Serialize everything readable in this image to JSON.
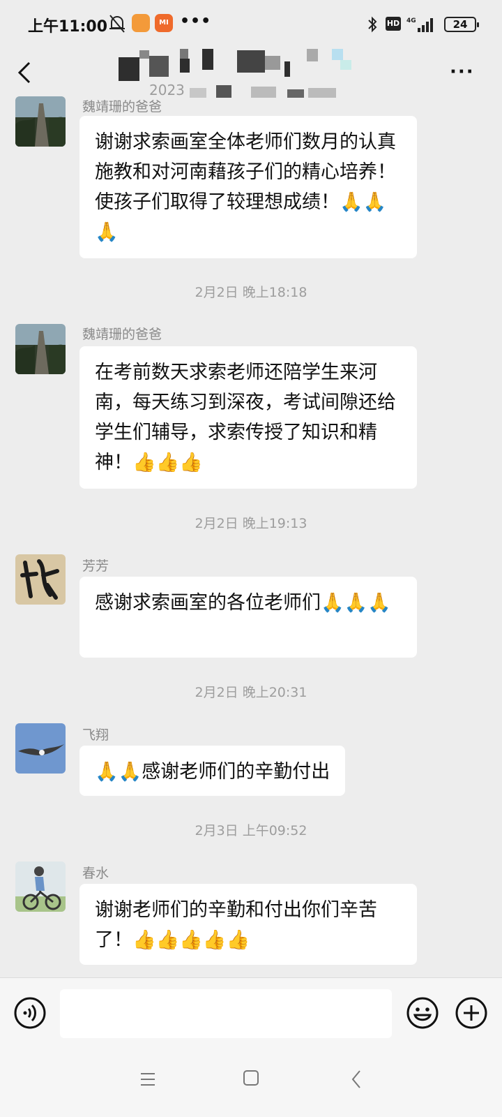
{
  "status_bar": {
    "time": "上午11:00",
    "app_icon_label": "MI",
    "more_dots": "•••",
    "hd_badge": "HD",
    "network": "4G",
    "battery": "24"
  },
  "header": {
    "more_label": "···"
  },
  "messages": [
    {
      "sender": "魏靖珊的爸爸",
      "text": "谢谢求索画室全体老师们数月的认真施教和对河南藉孩子们的精心培养！使孩子们取得了较理想成绩！🙏🙏🙏",
      "avatar": "mountain-photo"
    },
    {
      "sender": "魏靖珊的爸爸",
      "text": "在考前数天求索老师还陪学生来河南，每天练习到深夜，考试间隙还给学生们辅导，求索传授了知识和精神！👍👍👍",
      "avatar": "mountain-photo"
    },
    {
      "sender": "芳芳",
      "text": "感谢求索画室的各位老师们🙏🙏🙏",
      "avatar": "calligraphy"
    },
    {
      "sender": "飞翔",
      "text": "🙏🙏感谢老师们的辛勤付出",
      "avatar": "bird-sky"
    },
    {
      "sender": "春水",
      "text": "谢谢老师们的辛勤和付出你们辛苦了！👍👍👍👍👍",
      "avatar": "cyclist"
    }
  ],
  "timestamps": [
    "2月2日 晚上18:18",
    "2月2日 晚上19:13",
    "2月2日 晚上20:31",
    "2月3日 上午09:52"
  ],
  "input_bar": {
    "placeholder": ""
  }
}
